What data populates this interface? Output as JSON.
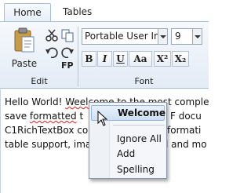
{
  "ribbon": {
    "tabs": [
      {
        "label": "Home",
        "active": true
      },
      {
        "label": "Tables",
        "active": false
      }
    ],
    "groups": {
      "edit": {
        "label": "Edit",
        "paste_label": "Paste",
        "format_painter_label": "FP",
        "icons": [
          "paste-icon",
          "cut-icon",
          "copy-icon",
          "undo-icon",
          "redo-icon"
        ]
      },
      "font": {
        "label": "Font",
        "font_family": "Portable User Ir",
        "font_size": "9",
        "buttons": {
          "bold": "B",
          "italic": "I",
          "underline": "U",
          "case": "Aa",
          "superscript": "X²",
          "subscript": "X₂"
        }
      }
    }
  },
  "editor": {
    "lines": [
      {
        "before": "Hello World! ",
        "misspelled": "Weelcome",
        "after": " to the most comple"
      },
      {
        "before": "save ",
        "misspelled": "formatted",
        "after": " t",
        "after2": "F docu"
      },
      {
        "before": "C1RichTextBox co",
        "misspelled": "",
        "after": "",
        "after2": "formati"
      },
      {
        "before": "table support, ima",
        "misspelled": "",
        "after": "",
        "after2": "l and mo"
      }
    ]
  },
  "context_menu": {
    "suggestion": "Welcome",
    "items": [
      "Ignore All",
      "Add",
      "Spelling"
    ]
  },
  "colors": {
    "ribbon_border": "#a9bfd6",
    "highlight": "#cfe0f3",
    "spell_error": "#e02020"
  }
}
